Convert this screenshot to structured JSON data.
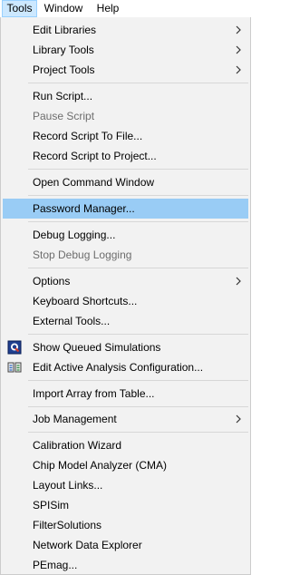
{
  "menubar": {
    "tools": "Tools",
    "window": "Window",
    "help": "Help"
  },
  "menu": {
    "edit_libraries": "Edit Libraries",
    "library_tools": "Library Tools",
    "project_tools": "Project Tools",
    "run_script": "Run Script...",
    "pause_script": "Pause Script",
    "record_script_to_file": "Record Script To File...",
    "record_script_to_project": "Record Script to Project...",
    "open_command_window": "Open Command Window",
    "password_manager": "Password Manager...",
    "debug_logging": "Debug Logging...",
    "stop_debug_logging": "Stop Debug Logging",
    "options": "Options",
    "keyboard_shortcuts": "Keyboard Shortcuts...",
    "external_tools": "External Tools...",
    "show_queued_simulations": "Show Queued Simulations",
    "edit_active_analysis_configuration": "Edit Active Analysis Configuration...",
    "import_array_from_table": "Import Array from Table...",
    "job_management": "Job Management",
    "calibration_wizard": "Calibration Wizard",
    "chip_model_analyzer": "Chip Model Analyzer (CMA)",
    "layout_links": "Layout Links...",
    "spisim": "SPISim",
    "filtersolutions": "FilterSolutions",
    "network_data_explorer": "Network Data Explorer",
    "pemag": "PEmag..."
  },
  "icons": {
    "queued_simulations": "queue-q-icon",
    "analysis_configuration": "analysis-config-icon",
    "submenu": "chevron-right-icon"
  },
  "colors": {
    "menu_background": "#f2f2f2",
    "highlight": "#99ccf5",
    "menubar_active": "#cce8ff",
    "disabled_text": "#6d6d6d"
  }
}
